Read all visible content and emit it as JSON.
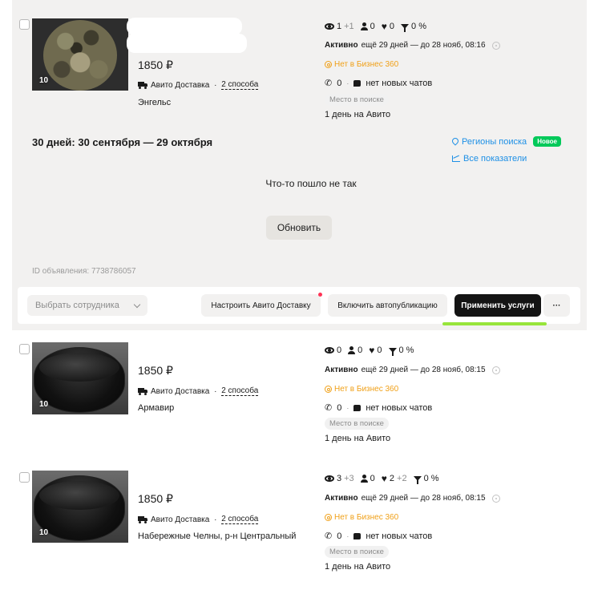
{
  "listings": [
    {
      "photo_count": "10",
      "price": "1850 ₽",
      "delivery_label": "Авито Доставка",
      "delivery_sep": " · ",
      "delivery_link": "2 способа",
      "city": "Энгельс",
      "views": "1",
      "views_plus": "+1",
      "contacts": "0",
      "favorites": "0",
      "conversion": "0 %",
      "status_bold": "Активно",
      "status_text": "ещё 29 дней — до 28 нояб, 08:16",
      "business": "Нет в Бизнес 360",
      "calls": "0",
      "chats": "нет новых чатов",
      "search_place": "Место в поиске",
      "on_avito": "1 день на Авито"
    },
    {
      "photo_count": "10",
      "price": "1850 ₽",
      "delivery_label": "Авито Доставка",
      "delivery_sep": " · ",
      "delivery_link": "2 способа",
      "city": "Армавир",
      "views": "0",
      "views_plus": "",
      "contacts": "0",
      "favorites": "0",
      "conversion": "0 %",
      "status_bold": "Активно",
      "status_text": "ещё 29 дней — до 28 нояб, 08:15",
      "business": "Нет в Бизнес 360",
      "calls": "0",
      "chats": "нет новых чатов",
      "search_place": "Место в поиске",
      "on_avito": "1 день на Авито"
    },
    {
      "photo_count": "10",
      "price": "1850 ₽",
      "delivery_label": "Авито Доставка",
      "delivery_sep": " · ",
      "delivery_link": "2 способа",
      "city": "Набережные Челны, р-н Центральный",
      "views": "3",
      "views_plus": "+3",
      "contacts": "0",
      "favorites": "2",
      "favorites_plus": "+2",
      "conversion": "0 %",
      "status_bold": "Активно",
      "status_text": "ещё 29 дней — до 28 нояб, 08:15",
      "business": "Нет в Бизнес 360",
      "calls": "0",
      "chats": "нет новых чатов",
      "search_place": "Место в поиске",
      "on_avito": "1 день на Авито"
    }
  ],
  "stats_panel": {
    "period": "30 дней: 30 сентября — 29 октября",
    "regions_link": "Регионы поиска",
    "new_badge": "Новое",
    "all_stats_link": "Все показатели",
    "error_text": "Что-то пошло не так",
    "refresh_label": "Обновить",
    "ad_id": "ID объявления: 7738786057"
  },
  "actions": {
    "employee_placeholder": "Выбрать сотрудника",
    "setup_delivery": "Настроить Авито Доставку",
    "autopublish": "Включить автопубликацию",
    "apply_services": "Применить услуги",
    "more": "···"
  },
  "icons": [
    "eye-icon",
    "user-icon",
    "heart-icon",
    "filter-icon",
    "info-icon",
    "business-icon",
    "phone-icon",
    "chat-icon",
    "truck-icon",
    "pin-icon",
    "chart-icon",
    "chevron-down-icon"
  ],
  "colors": {
    "panel_bg": "#f2f1f0",
    "link_blue": "#1e90e6",
    "business_orange": "#f0a018",
    "badge_green": "#03c95a",
    "primary_dark": "#141414",
    "underline_green": "#97e53a",
    "notification_red": "#ff3355"
  }
}
